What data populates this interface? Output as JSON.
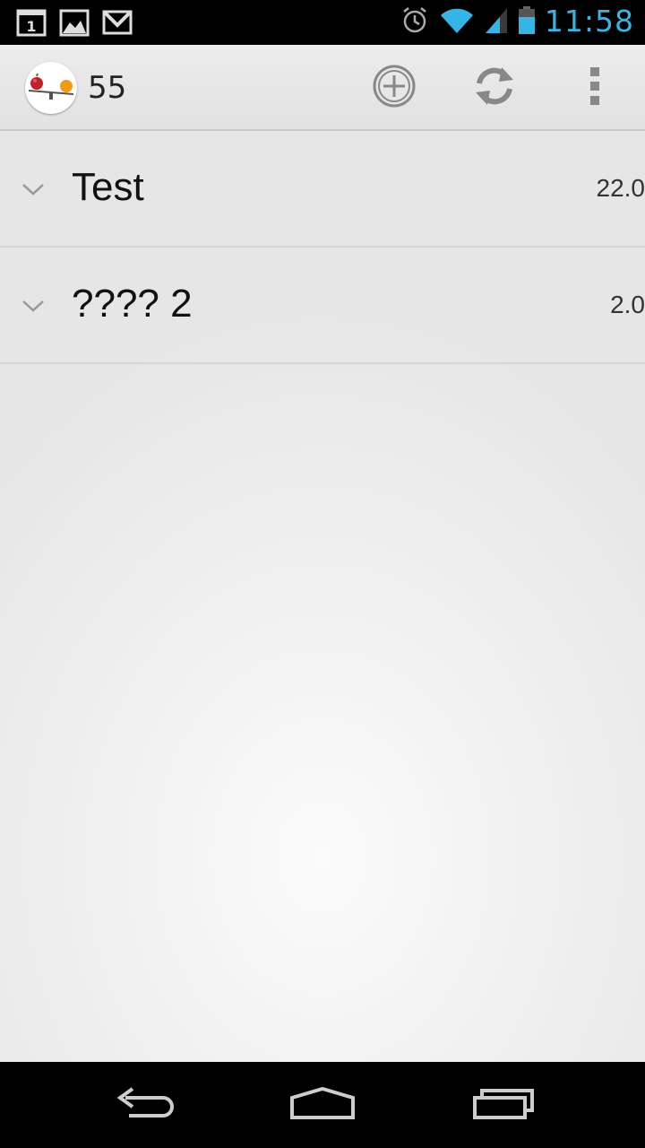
{
  "status_bar": {
    "time": "11:58",
    "notification_icons": [
      "calendar-icon",
      "gallery-icon",
      "gmail-icon"
    ],
    "calendar_day": "1",
    "system_icons": [
      "alarm-icon",
      "wifi-icon",
      "signal-icon",
      "battery-icon"
    ],
    "clock_color": "#33b5e5"
  },
  "action_bar": {
    "title": "55",
    "logo_icon": "scale-apple-orange-icon",
    "actions": [
      "add-circle-icon",
      "refresh-icon",
      "overflow-menu-icon"
    ]
  },
  "list": {
    "items": [
      {
        "name": "Test",
        "value": "22.0"
      },
      {
        "name": "???? 2",
        "value": "2.0"
      }
    ]
  },
  "nav_bar": {
    "buttons": [
      "back-icon",
      "home-icon",
      "recents-icon"
    ]
  }
}
